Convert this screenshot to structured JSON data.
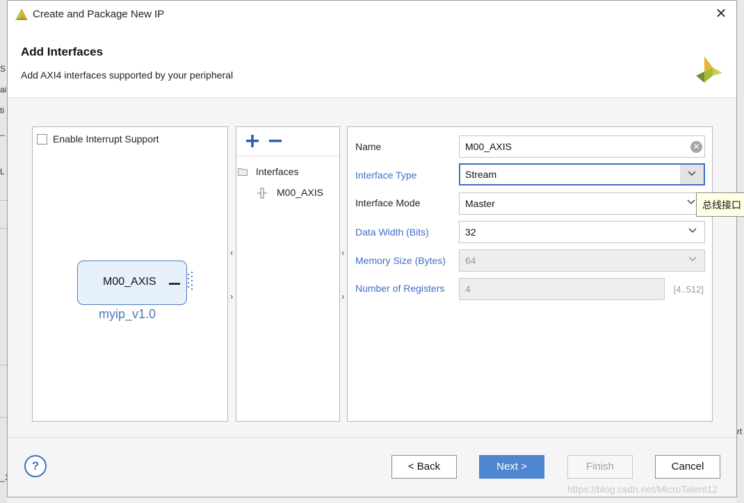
{
  "window": {
    "title": "Create and Package New IP",
    "close_symbol": "✕"
  },
  "header": {
    "title": "Add Interfaces",
    "subtitle": "Add AXI4 interfaces supported by your peripheral"
  },
  "left_panel": {
    "interrupt_label": "Enable Interrupt Support",
    "interrupt_checked": false,
    "ip_block": {
      "port_name": "M00_AXIS",
      "ip_name": "myip_v1.0"
    }
  },
  "middle_panel": {
    "add_symbol": "+",
    "remove_symbol": "−",
    "tree": {
      "root_label": "Interfaces",
      "items": [
        {
          "label": "M00_AXIS"
        }
      ]
    }
  },
  "right_panel": {
    "fields": [
      {
        "label": "Name",
        "value": "M00_AXIS",
        "highlight": false
      },
      {
        "label": "Interface Type",
        "value": "Stream",
        "highlight": true
      },
      {
        "label": "Interface Mode",
        "value": "Master",
        "highlight": false
      },
      {
        "label": "Data Width (Bits)",
        "value": "32",
        "highlight": true
      },
      {
        "label": "Memory Size (Bytes)",
        "value": "64",
        "highlight": true
      },
      {
        "label": "Number of Registers",
        "value": "4",
        "highlight": true
      }
    ],
    "registers_range": "[4..512]"
  },
  "tooltip": {
    "text": "总线接口"
  },
  "splitters": {
    "collapse": "‹",
    "expand": "›"
  },
  "footer": {
    "help": "?",
    "back": "< Back",
    "next": "Next >",
    "finish": "Finish",
    "cancel": "Cancel"
  },
  "watermark": "https://blog.csdn.net/MicroTalent12",
  "background_fragments": [
    "S",
    "ai",
    "ti",
    "_",
    "L",
    "rt",
    "_1"
  ],
  "colors": {
    "accent": "#4f86d1",
    "link_blue": "#3f6fc4",
    "ip_block_fill": "#e6f1fb"
  }
}
